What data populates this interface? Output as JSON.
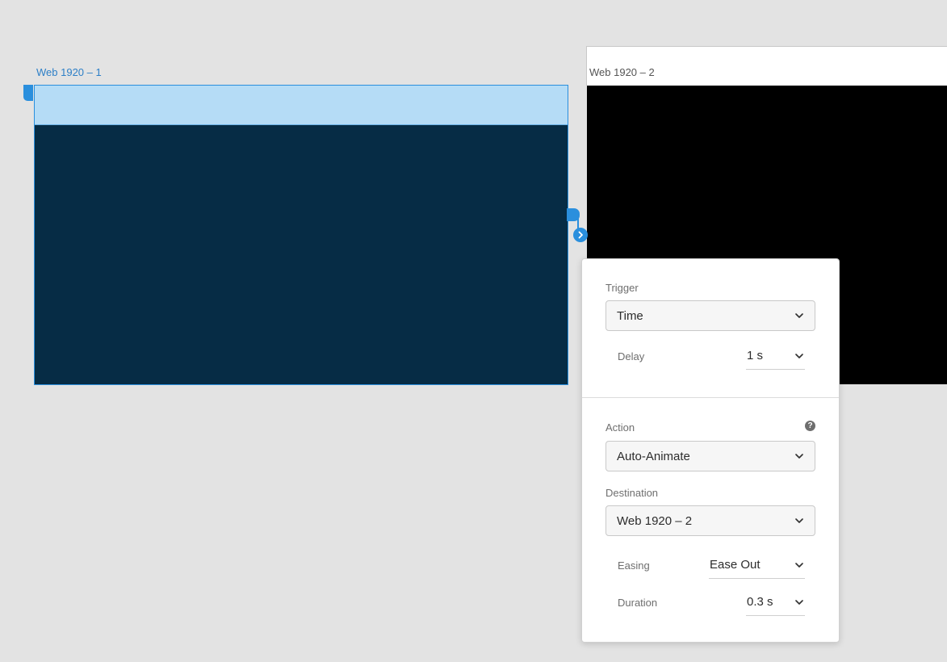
{
  "artboards": {
    "first": {
      "title": "Web 1920 – 1",
      "band_color": "#b5dcf6",
      "body_color": "#062c45",
      "border_color": "#2a8fdd"
    },
    "second": {
      "title": "Web 1920 – 2",
      "body_color": "#000000"
    }
  },
  "panel": {
    "trigger": {
      "label": "Trigger",
      "value": "Time"
    },
    "delay": {
      "label": "Delay",
      "value": "1 s"
    },
    "action": {
      "label": "Action",
      "value": "Auto-Animate",
      "help_icon": "question-circle-icon"
    },
    "destination": {
      "label": "Destination",
      "value": "Web 1920 – 2"
    },
    "easing": {
      "label": "Easing",
      "value": "Ease Out"
    },
    "duration": {
      "label": "Duration",
      "value": "0.3 s"
    }
  },
  "icons": {
    "dropdown": "chevron-down-icon",
    "wire_target": "chevron-right-icon",
    "help_glyph": "?"
  },
  "colors": {
    "accent": "#2a8fdd",
    "canvas": "#e3e3e3"
  }
}
